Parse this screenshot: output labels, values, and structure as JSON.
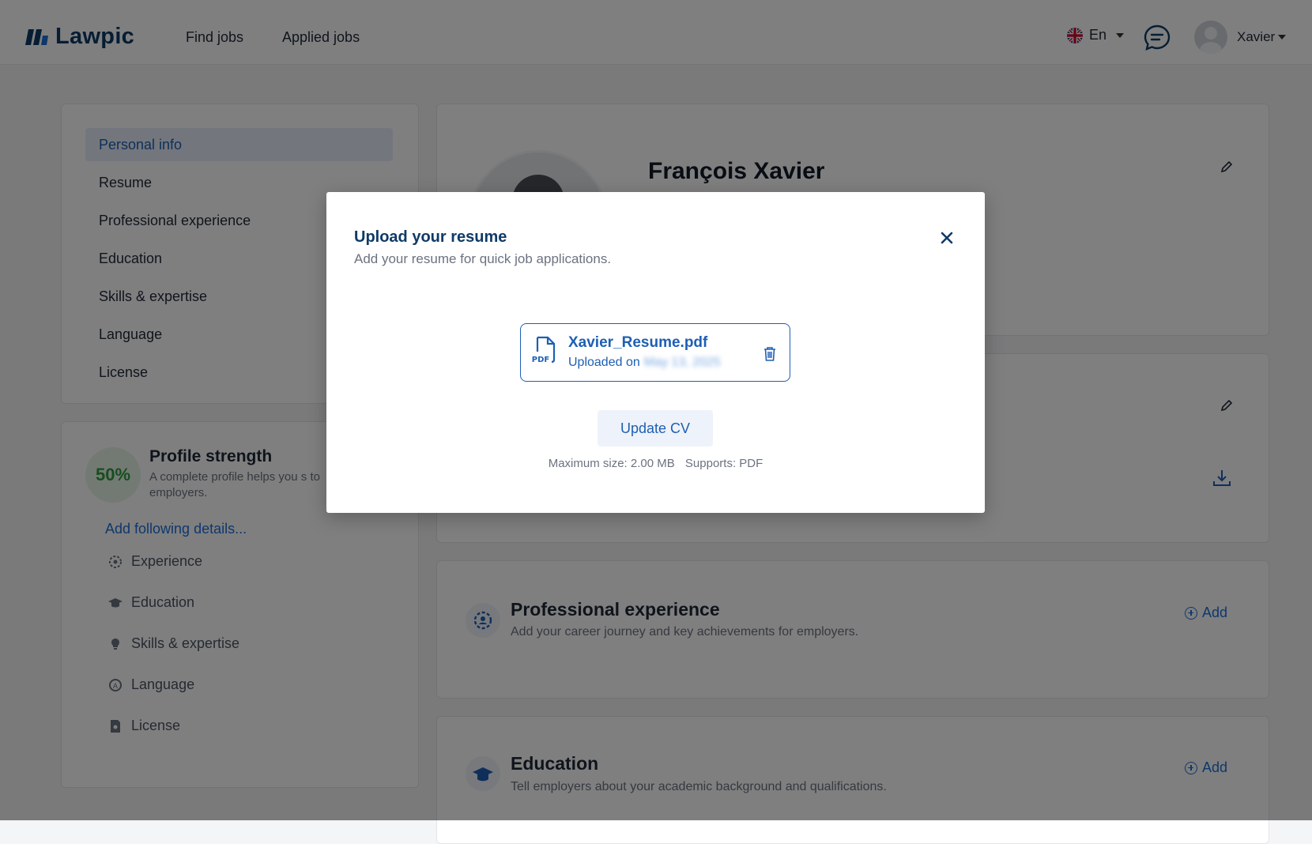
{
  "brand": {
    "name": "Lawpic"
  },
  "nav": {
    "find_jobs": "Find jobs",
    "applied_jobs": "Applied jobs"
  },
  "lang": {
    "code": "En"
  },
  "user": {
    "name": "Xavier"
  },
  "sidebar": {
    "items": [
      {
        "label": "Personal info",
        "active": true
      },
      {
        "label": "Resume"
      },
      {
        "label": "Professional experience"
      },
      {
        "label": "Education"
      },
      {
        "label": "Skills & expertise"
      },
      {
        "label": "Language"
      },
      {
        "label": "License"
      }
    ]
  },
  "strength": {
    "percent": "50%",
    "title": "Profile strength",
    "desc": "A complete profile helps you s to employers.",
    "add_details": "Add following details...",
    "details": [
      {
        "label": "Experience",
        "icon": "experience-icon"
      },
      {
        "label": "Education",
        "icon": "graduation-cap-icon"
      },
      {
        "label": "Skills & expertise",
        "icon": "lightbulb-icon"
      },
      {
        "label": "Language",
        "icon": "language-icon"
      },
      {
        "label": "License",
        "icon": "license-icon"
      }
    ]
  },
  "profile": {
    "name": "François Xavier"
  },
  "sections": {
    "experience": {
      "title": "Professional experience",
      "desc": "Add your career journey and key achievements for employers.",
      "add": "Add"
    },
    "education": {
      "title": "Education",
      "desc": "Tell employers about your academic background and qualifications.",
      "add": "Add"
    }
  },
  "modal": {
    "title": "Upload your resume",
    "subtitle": "Add your resume for quick job applications.",
    "file_name": "Xavier_Resume.pdf",
    "uploaded_label": "Uploaded on",
    "uploaded_date": "May 13, 2025",
    "pdf_label": "PDF",
    "update_button": "Update CV",
    "max_size": "Maximum size: 2.00 MB",
    "supports": "Supports: PDF"
  },
  "colors": {
    "primary": "#1e5fb4",
    "brand": "#0d3b66",
    "success": "#2e9b3e"
  }
}
